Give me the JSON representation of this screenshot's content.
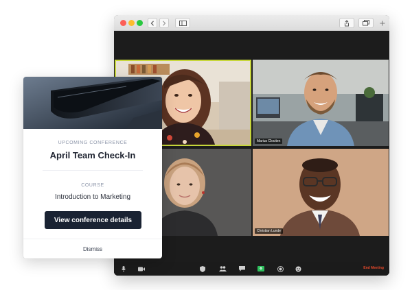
{
  "window": {
    "controls": [
      "close",
      "minimize",
      "maximize"
    ],
    "toolbar_icons": [
      "back-icon",
      "forward-icon",
      "sidebar-icon",
      "share-icon",
      "tabs-icon",
      "new-tab-icon"
    ]
  },
  "meeting": {
    "participants": [
      {
        "name": "",
        "active_speaker": true
      },
      {
        "name": "Marius Clociten",
        "active_speaker": false
      },
      {
        "name": "",
        "active_speaker": false
      },
      {
        "name": "Christian Lunde",
        "active_speaker": false
      }
    ],
    "toolbar": {
      "icons": [
        "microphone-icon",
        "camera-icon",
        "security-icon",
        "participants-icon",
        "chat-icon",
        "share-screen-icon",
        "record-icon",
        "reactions-icon"
      ],
      "end_label": "End Meeting"
    },
    "colors": {
      "active_border": "#c7d63a",
      "end_text": "#e8492b",
      "share_screen": "#2dbf5c"
    }
  },
  "card": {
    "eyebrow": "UPCOMING CONFERENCE",
    "title": "April Team Check-In",
    "course_label": "COURSE",
    "course_name": "Introduction to Marketing",
    "cta": "View conference details",
    "dismiss": "Dismiss",
    "colors": {
      "cta_bg": "#1a2333",
      "eyebrow": "#8b94a8"
    }
  }
}
